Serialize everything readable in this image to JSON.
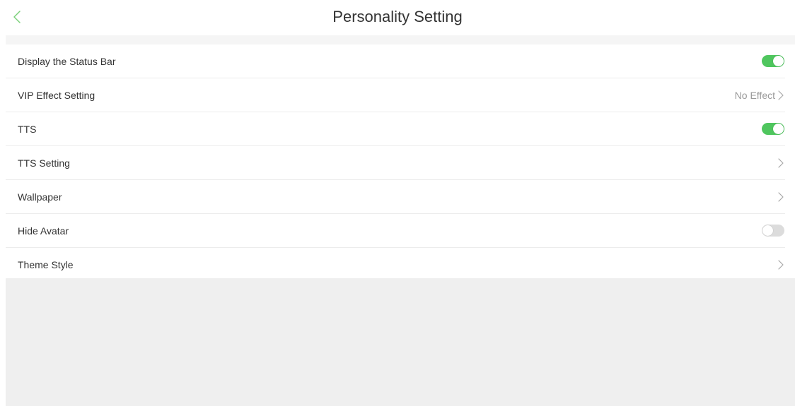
{
  "header": {
    "title": "Personality Setting",
    "back_icon": "chevron-left-icon",
    "accent_color": "#4fc65e"
  },
  "settings": [
    {
      "key": "display_status_bar",
      "label": "Display the Status Bar",
      "type": "toggle",
      "state": "on"
    },
    {
      "key": "vip_effect",
      "label": "VIP Effect Setting",
      "type": "link",
      "value": "No Effect"
    },
    {
      "key": "tts",
      "label": "TTS",
      "type": "toggle",
      "state": "on"
    },
    {
      "key": "tts_setting",
      "label": "TTS Setting",
      "type": "link",
      "value": ""
    },
    {
      "key": "wallpaper",
      "label": "Wallpaper",
      "type": "link",
      "value": ""
    },
    {
      "key": "hide_avatar",
      "label": "Hide Avatar",
      "type": "toggle",
      "state": "off"
    },
    {
      "key": "theme_style",
      "label": "Theme Style",
      "type": "link",
      "value": ""
    }
  ],
  "colors": {
    "toggle_on": "#4fc65e",
    "toggle_off": "#dcdcdc",
    "background_gray": "#efefef"
  }
}
